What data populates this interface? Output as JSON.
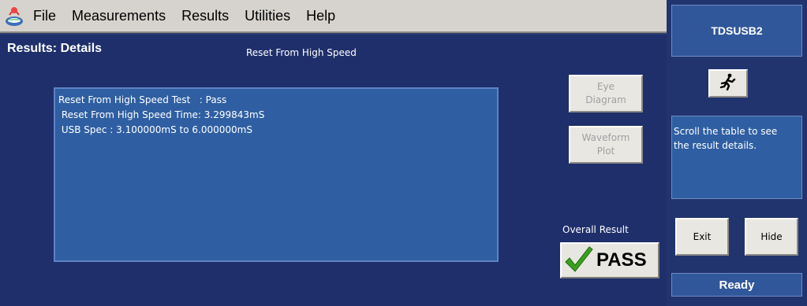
{
  "menu": {
    "items": [
      "File",
      "Measurements",
      "Results",
      "Utilities",
      "Help"
    ]
  },
  "main": {
    "title": "Results: Details",
    "test_name": "Reset From High Speed",
    "details": [
      "Reset From High Speed Test   : Pass",
      " Reset From High Speed Time: 3.299843mS",
      " USB Spec : 3.100000mS to 6.000000mS"
    ],
    "eye_diagram": [
      "Eye",
      "Diagram"
    ],
    "waveform_plot": [
      "Waveform",
      "Plot"
    ],
    "overall_label": "Overall Result",
    "overall_value": "PASS"
  },
  "right": {
    "title": "TDSUSB2",
    "info_line1": "Scroll the table to see",
    "info_line2": "the result details.",
    "exit_label": "Exit",
    "hide_label": "Hide",
    "status": "Ready"
  },
  "icons": {
    "app": "app-logo-icon",
    "run": "running-man-icon",
    "pass_check": "checkmark-icon"
  },
  "colors": {
    "pass_check": "#3aa01e",
    "panel": "#1f2f6b",
    "details_bg": "#2f5fa2"
  }
}
